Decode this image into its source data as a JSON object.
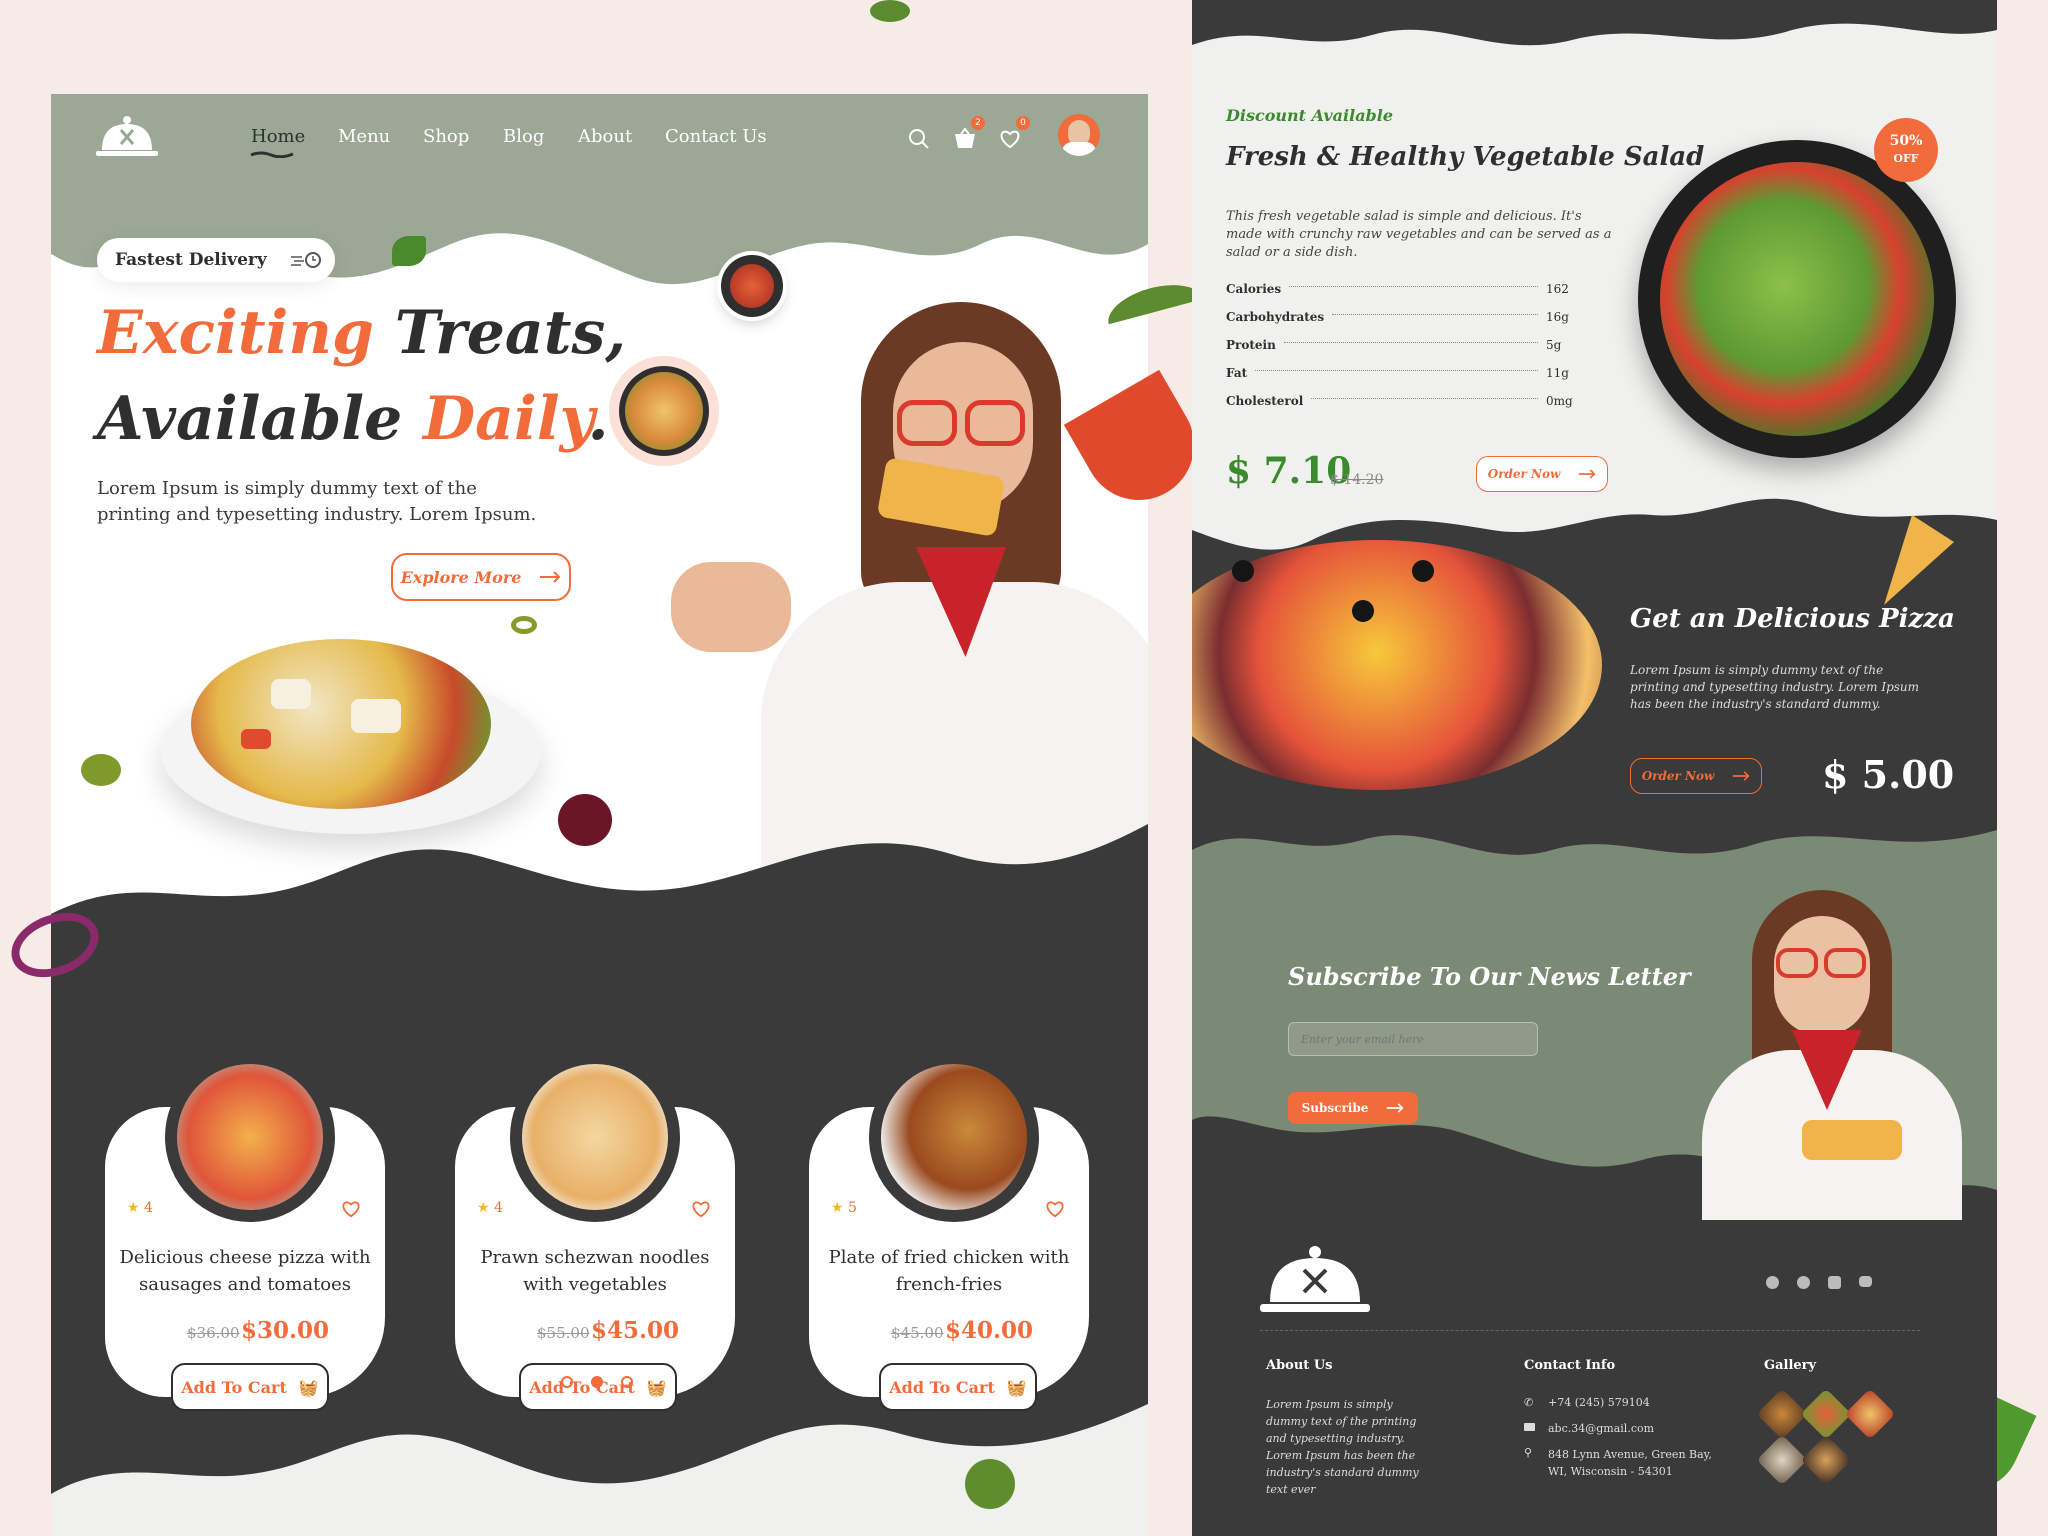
{
  "colors": {
    "accent": "#f26b3a",
    "sage": "#9aa895",
    "dark": "#3a3a3a",
    "green": "#3c8a2e",
    "cream": "#f0f1ee"
  },
  "nav": {
    "items": [
      {
        "label": "Home",
        "active": true
      },
      {
        "label": "Menu"
      },
      {
        "label": "Shop"
      },
      {
        "label": "Blog"
      },
      {
        "label": "About"
      },
      {
        "label": "Contact Us"
      }
    ],
    "cart_count": "2",
    "wishlist_count": "0"
  },
  "hero": {
    "badge": "Fastest Delivery",
    "title_line1_a": "Exciting",
    "title_line1_b": " Treats,",
    "title_line2_a": "Available ",
    "title_line2_b": "Daily",
    "title_line2_c": ".",
    "description": "Lorem Ipsum is simply dummy text of the printing and typesetting industry. Lorem Ipsum.",
    "cta": "Explore More"
  },
  "products": [
    {
      "name": "Delicious cheese pizza with sausages and tomatoes",
      "rating": "4",
      "old_price": "$36.00",
      "price": "$30.00",
      "cta": "Add To Cart"
    },
    {
      "name": "Prawn schezwan noodles with vegetables",
      "rating": "4",
      "old_price": "$55.00",
      "price": "$45.00",
      "cta": "Add To Cart"
    },
    {
      "name": "Plate of fried chicken with french-fries",
      "rating": "5",
      "old_price": "$45.00",
      "price": "$40.00",
      "cta": "Add To Cart"
    }
  ],
  "carousel": {
    "pages": 3,
    "active": 1
  },
  "salad": {
    "tag": "Discount Available",
    "title": "Fresh & Healthy Vegetable Salad",
    "description": "This fresh vegetable salad is simple and delicious. It's made with crunchy raw vegetables and can be served as a salad or a side dish.",
    "nutrition": [
      {
        "label": "Calories",
        "value": "162"
      },
      {
        "label": "Carbohydrates",
        "value": "16g"
      },
      {
        "label": "Protein",
        "value": "5g"
      },
      {
        "label": "Fat",
        "value": "11g"
      },
      {
        "label": "Cholesterol",
        "value": "0mg"
      }
    ],
    "price": "$ 7.10",
    "old_price": "$ 14.20",
    "cta": "Order Now",
    "badge_pct": "50%",
    "badge_off": "OFF"
  },
  "pizza": {
    "title": "Get an Delicious Pizza",
    "description": "Lorem Ipsum is simply dummy text of the printing and typesetting industry. Lorem Ipsum has been the industry's standard dummy.",
    "cta": "Order Now",
    "price": "$ 5.00"
  },
  "newsletter": {
    "title": "Subscribe To Our News Letter",
    "placeholder": "Enter your email here",
    "cta": "Subscribe"
  },
  "footer": {
    "about_h": "About Us",
    "about_t": "Lorem Ipsum is simply dummy text of the printing and typesetting industry. Lorem Ipsum has been the industry's standard dummy text ever",
    "contact_h": "Contact Info",
    "phone": "+74 (245) 579104",
    "email": "abc.34@gmail.com",
    "address": "848 Lynn Avenue, Green Bay, WI, Wisconsin - 54301",
    "gallery_h": "Gallery"
  }
}
